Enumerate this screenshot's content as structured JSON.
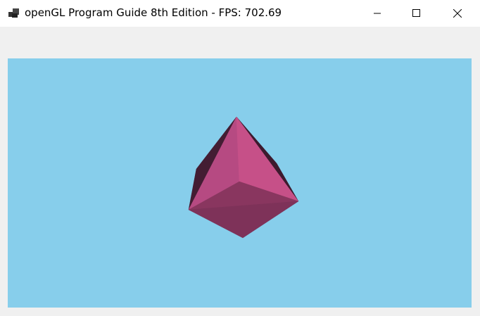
{
  "window": {
    "title": "openGL Program Guide 8th Edition - FPS: 702.69"
  },
  "colors": {
    "background": "#87ceeb",
    "face_front_left": "#b64a82",
    "face_front_right": "#c65088",
    "face_back_left": "#431d33",
    "face_back_right": "#3d1a2e",
    "face_bottom_upper": "#89365f",
    "face_bottom_lower": "#7e3259"
  }
}
